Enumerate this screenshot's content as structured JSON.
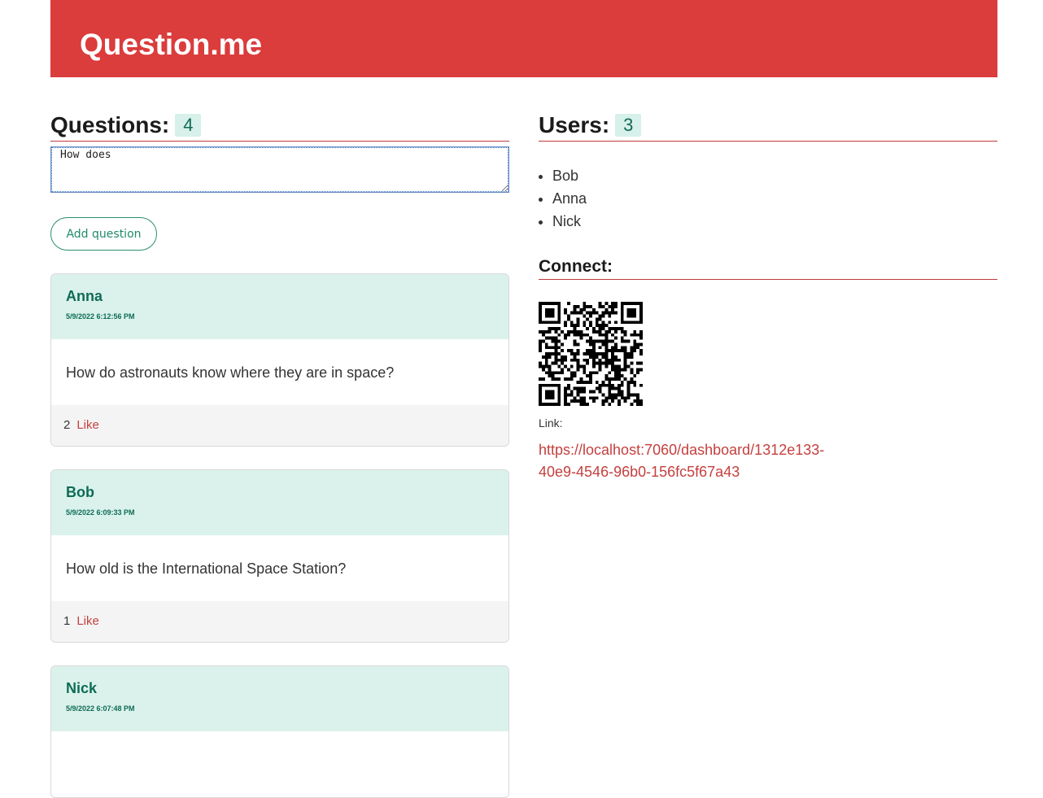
{
  "app": {
    "title": "Question.me"
  },
  "questions_section": {
    "heading": "Questions:",
    "count": "4",
    "input_value": "How does ",
    "add_button_label": "Add question",
    "items": [
      {
        "author": "Anna",
        "timestamp": "5/9/2022 6:12:56 PM",
        "text": "How do astronauts know where they are in space?",
        "likes": "2",
        "like_label": "Like"
      },
      {
        "author": "Bob",
        "timestamp": "5/9/2022 6:09:33 PM",
        "text": "How old is the International Space Station?",
        "likes": "1",
        "like_label": "Like"
      },
      {
        "author": "Nick",
        "timestamp": "5/9/2022 6:07:48 PM",
        "text": "",
        "likes": "",
        "like_label": ""
      }
    ]
  },
  "users_section": {
    "heading": "Users:",
    "count": "3",
    "users": [
      "Bob",
      "Anna",
      "Nick"
    ]
  },
  "connect_section": {
    "heading": "Connect:",
    "qr_icon": "qr-code-icon",
    "link_label": "Link:",
    "link_text": "https://localhost:7060/dashboard/1312e133-40e9-4546-96b0-156fc5f67a43"
  },
  "colors": {
    "brand_red": "#db3c3c",
    "accent_green": "#0f6b57",
    "card_header_bg": "#daf2eb",
    "link_red": "#c4403f"
  }
}
